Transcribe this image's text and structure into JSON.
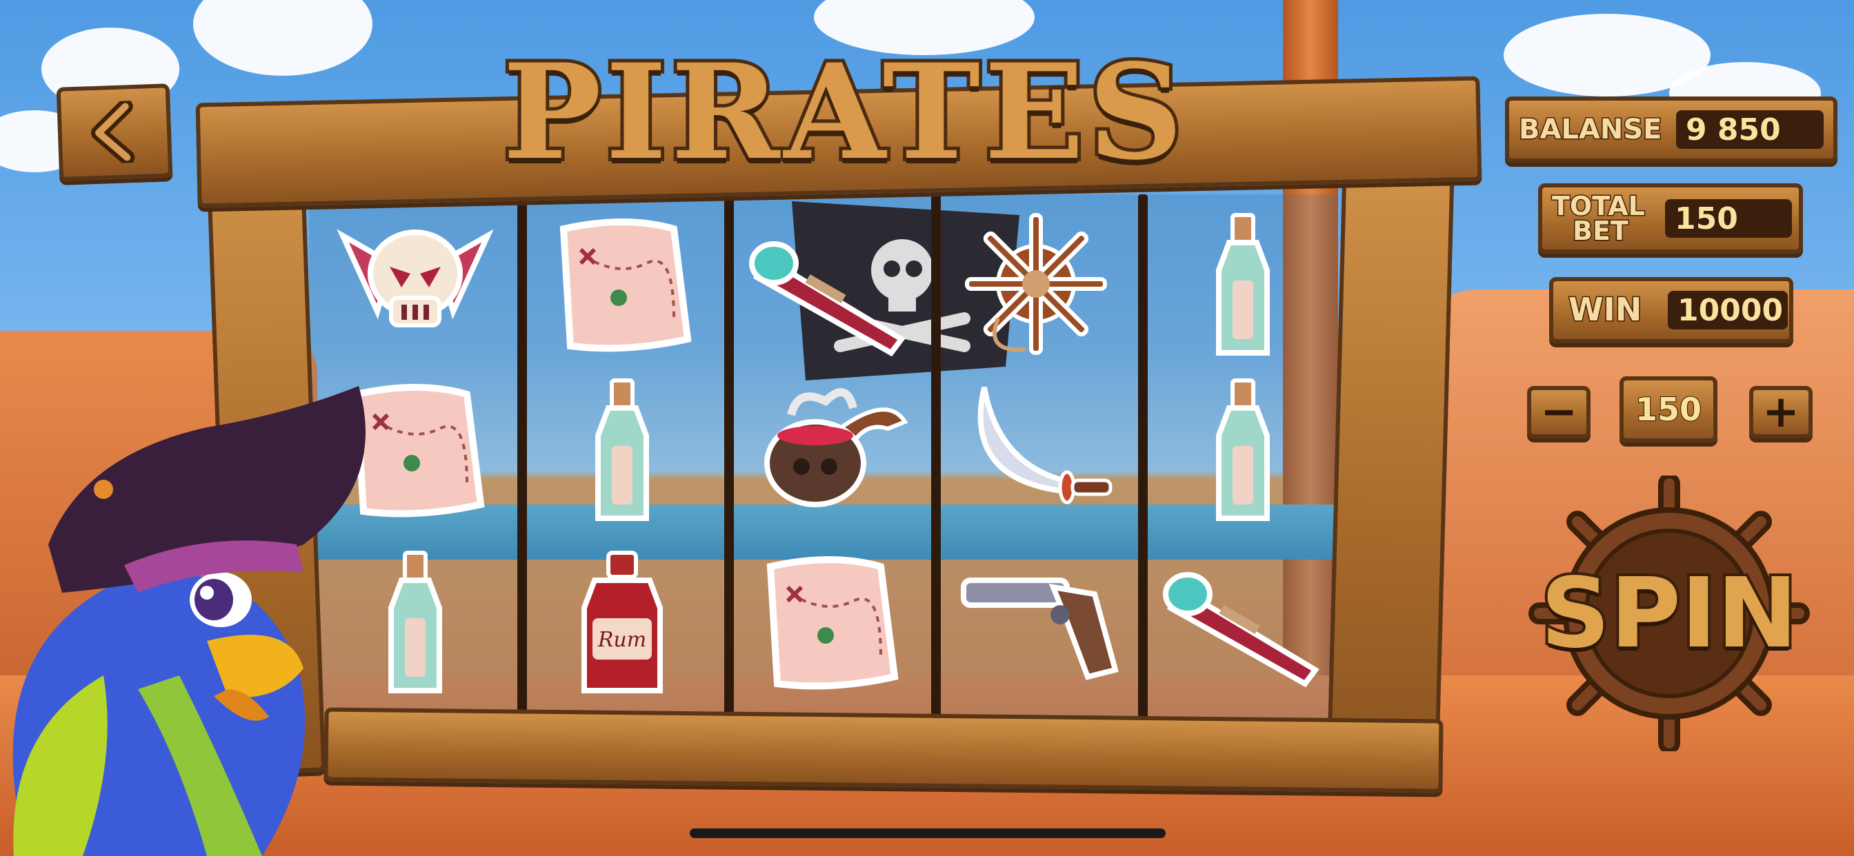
{
  "game": {
    "title": "PIRATES"
  },
  "hud": {
    "balance_label": "BALANSE",
    "balance_value": "9 850",
    "total_bet_label_line1": "TOTAL",
    "total_bet_label_line2": "BET",
    "total_bet_value": "150",
    "win_label": "WIN",
    "win_value": "10000",
    "bet_stepper_value": "150",
    "minus_label": "−",
    "plus_label": "+"
  },
  "spin": {
    "label": "SPIN"
  },
  "reels": [
    [
      "skull-crossbones",
      "treasure-map",
      "message-bottle"
    ],
    [
      "treasure-map",
      "message-bottle",
      "rum-bottle"
    ],
    [
      "spyglass",
      "skull-pipe",
      "treasure-map"
    ],
    [
      "ship-wheel",
      "cutlass",
      "flintlock-pistol"
    ],
    [
      "message-bottle",
      "message-bottle",
      "spyglass"
    ]
  ],
  "symbols": {
    "rum_text": "Rum"
  },
  "colors": {
    "wood_light": "#cf9147",
    "wood_dark": "#5a3515",
    "text_gold": "#fde29e",
    "sky": "#4f9ae3"
  }
}
